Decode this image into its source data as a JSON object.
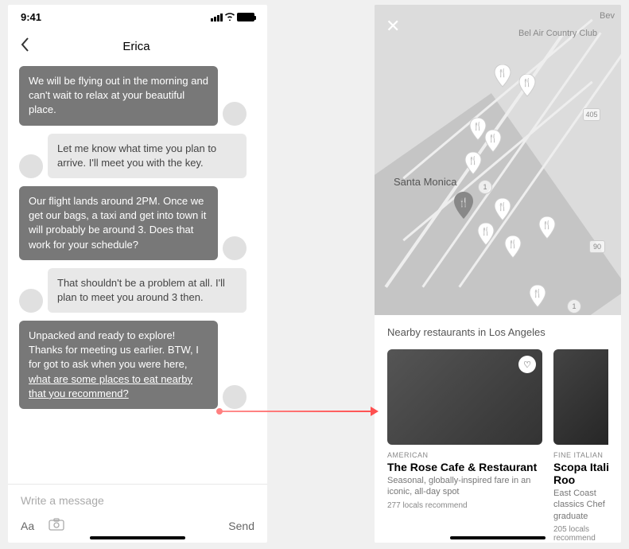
{
  "status": {
    "time": "9:41"
  },
  "chat": {
    "title": "Erica",
    "messages": [
      {
        "dir": "out",
        "text": "We will be flying out in the morning and can't wait to relax at your beautiful place."
      },
      {
        "dir": "in",
        "text": "Let me know what time you plan to arrive. I'll meet you with the key."
      },
      {
        "dir": "out",
        "text": "Our flight lands around 2PM. Once we get our bags, a taxi and get into town it will probably be around 3. Does that work for your schedule?"
      },
      {
        "dir": "in",
        "text": "That shouldn't be a problem at all. I'll plan to meet you around 3 then."
      },
      {
        "dir": "out",
        "text_pre": "Unpacked and ready to explore! Thanks for meeting us earlier. BTW, I for got to ask when you were here, ",
        "text_link": "what are some places to eat nearby that you recommend?"
      }
    ],
    "composer": {
      "placeholder": "Write a message",
      "aa": "Aa",
      "send": "Send"
    }
  },
  "map": {
    "labels": {
      "santa_monica": "Santa Monica",
      "bel_air": "Bel Air\nCountry Club",
      "bev": "Bev"
    },
    "sheet_title": "Nearby restaurants in Los Angeles",
    "cards": [
      {
        "cat": "AMERICAN",
        "title": "The Rose Cafe & Restaurant",
        "desc": "Seasonal, globally-inspired fare in an iconic, all-day spot",
        "rec": "277 locals recommend"
      },
      {
        "cat": "FINE ITALIAN",
        "title": "Scopa Italian Roo",
        "desc": "East Coast classics\nChef graduate",
        "rec": "205 locals recommend"
      }
    ]
  }
}
